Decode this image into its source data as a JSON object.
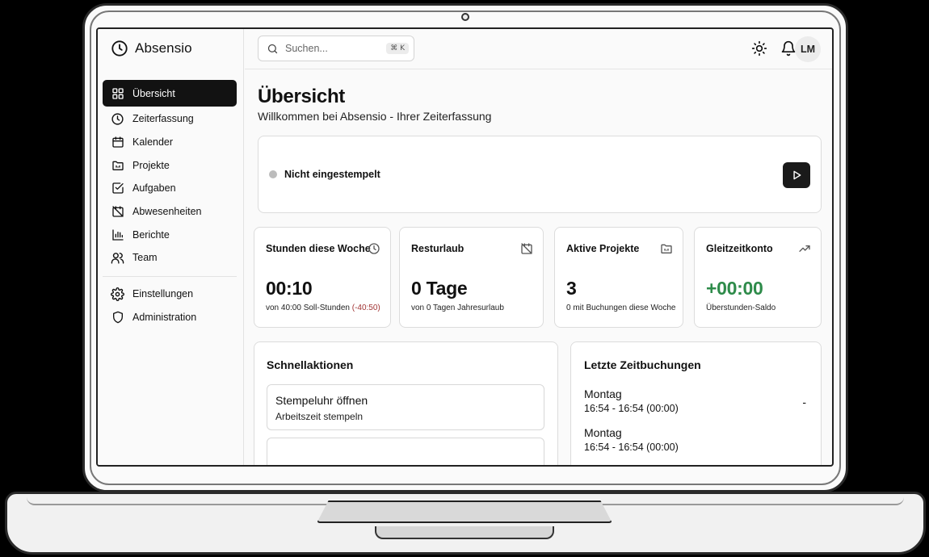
{
  "app": {
    "brand": "Absensio"
  },
  "sidebar": {
    "items": [
      {
        "label": "Übersicht",
        "icon": "grid-icon"
      },
      {
        "label": "Zeiterfassung",
        "icon": "clock-icon"
      },
      {
        "label": "Kalender",
        "icon": "calendar-icon"
      },
      {
        "label": "Projekte",
        "icon": "folder-icon"
      },
      {
        "label": "Aufgaben",
        "icon": "checkbox-icon"
      },
      {
        "label": "Abwesenheiten",
        "icon": "calendar-off-icon"
      },
      {
        "label": "Berichte",
        "icon": "bar-chart-icon"
      },
      {
        "label": "Team",
        "icon": "users-icon"
      }
    ],
    "bottom_items": [
      {
        "label": "Einstellungen",
        "icon": "gear-icon"
      },
      {
        "label": "Administration",
        "icon": "shield-icon"
      }
    ]
  },
  "topbar": {
    "search_placeholder": "Suchen...",
    "search_shortcut": "⌘ K",
    "avatar_initials": "LM"
  },
  "page": {
    "title": "Übersicht",
    "subtitle": "Willkommen bei Absensio - Ihrer Zeiterfassung"
  },
  "clock": {
    "status": "Nicht eingestempelt"
  },
  "stats": [
    {
      "title": "Stunden diese Woche",
      "value": "00:10",
      "note": "von 40:00 Soll-Stunden",
      "note_delta": "(-40:50)",
      "icon": "clock-icon"
    },
    {
      "title": "Resturlaub",
      "value": "0 Tage",
      "note": "von 0 Tagen Jahresurlaub",
      "icon": "calendar-off-icon"
    },
    {
      "title": "Aktive Projekte",
      "value": "3",
      "note": "0 mit Buchungen diese Woche",
      "icon": "folder-icon"
    },
    {
      "title": "Gleitzeitkonto",
      "value": "+00:00",
      "note": "Überstunden-Saldo",
      "icon": "trending-up-icon"
    }
  ],
  "colors": {
    "negative": "#a13434",
    "positive": "#2e8b4a",
    "active_nav": "#121212"
  },
  "quick_actions": {
    "title": "Schnellaktionen",
    "items": [
      {
        "title": "Stempeluhr öffnen",
        "desc": "Arbeitszeit stempeln"
      }
    ]
  },
  "recent_bookings": {
    "title": "Letzte Zeitbuchungen",
    "items": [
      {
        "day": "Montag",
        "time": "16:54 - 16:54 (00:00)",
        "extra": "-"
      },
      {
        "day": "Montag",
        "time": "16:54 - 16:54 (00:00)"
      }
    ]
  }
}
